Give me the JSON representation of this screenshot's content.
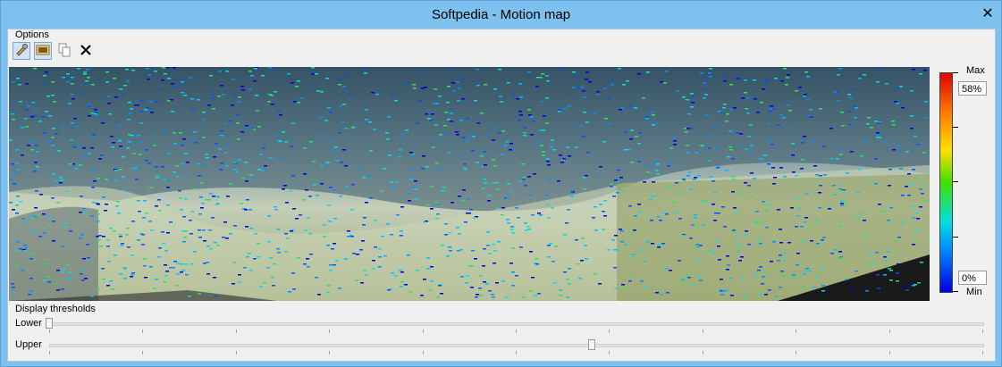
{
  "window": {
    "title": "Softpedia - Motion map",
    "close_glyph": "✕"
  },
  "options": {
    "group_label": "Options",
    "toolbar": [
      {
        "name": "settings-icon",
        "active": true
      },
      {
        "name": "image-icon",
        "active": true
      },
      {
        "name": "copy-icon",
        "active": false
      },
      {
        "name": "delete-icon",
        "active": false
      }
    ]
  },
  "scale": {
    "max_label": "Max",
    "min_label": "Min",
    "max_value": "58%",
    "min_value": "0%",
    "gradient": [
      "#e00000",
      "#ff7a00",
      "#ffe000",
      "#40e000",
      "#00e0e0",
      "#0080ff",
      "#0000e0"
    ]
  },
  "thresholds": {
    "group_label": "Display thresholds",
    "lower_label": "Lower",
    "upper_label": "Upper",
    "lower_value": 0.0,
    "upper_value": 0.58,
    "tick_count": 11
  }
}
